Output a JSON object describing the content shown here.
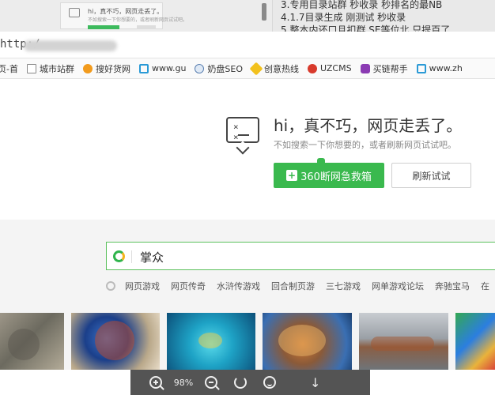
{
  "background_window": {
    "error_snippet": "hi，真不巧，网页走丢了。",
    "error_snippet_sub": "不如搜索一下你想要的，或者刷新网页试试吧。",
    "lines": [
      "3.专用目录站群  秒收录 秒排名的最NB",
      "4.1.7目录生成  刚测试      秒收录",
      "5.整本内还口且扣群 SE等位北 只提百了"
    ]
  },
  "address_bar": {
    "url_prefix": "http:/"
  },
  "bookmarks": [
    {
      "label": "页-首",
      "icon": "doc-icon"
    },
    {
      "label": "城市站群",
      "icon": "doc-icon"
    },
    {
      "label": "搜好货网",
      "icon": "s-logo-icon"
    },
    {
      "label": "www.gu",
      "icon": "bracket-icon"
    },
    {
      "label": "奶盘SEO",
      "icon": "globe-icon"
    },
    {
      "label": "创意热线",
      "icon": "gear-icon"
    },
    {
      "label": "UZCMS",
      "icon": "red-logo-icon"
    },
    {
      "label": "买链帮手",
      "icon": "purple-logo-icon"
    },
    {
      "label": "www.zh",
      "icon": "bracket-icon"
    }
  ],
  "error_page": {
    "title": "hi，真不巧，网页走丢了。",
    "subtitle": "不如搜索一下你想要的，或者刷新网页试试吧。",
    "face_eyes": "× ×",
    "rescue_button": "360断网急救箱",
    "retry_button": "刷新试试"
  },
  "search": {
    "value": "掌众"
  },
  "hot_links": [
    "网页游戏",
    "网页传奇",
    "水浒传游戏",
    "回合制页游",
    "三七游戏",
    "网单游戏论坛",
    "奔驰宝马",
    "在"
  ],
  "image_strip": {
    "thumbnails": [
      "industrial-machine-thumb",
      "dragon-art-thumb",
      "fish-game-thumb",
      "battle-game-thumb",
      "rotary-kiln-thumb",
      "app-icons-thumb"
    ]
  },
  "toolbar": {
    "zoom": "98%"
  }
}
